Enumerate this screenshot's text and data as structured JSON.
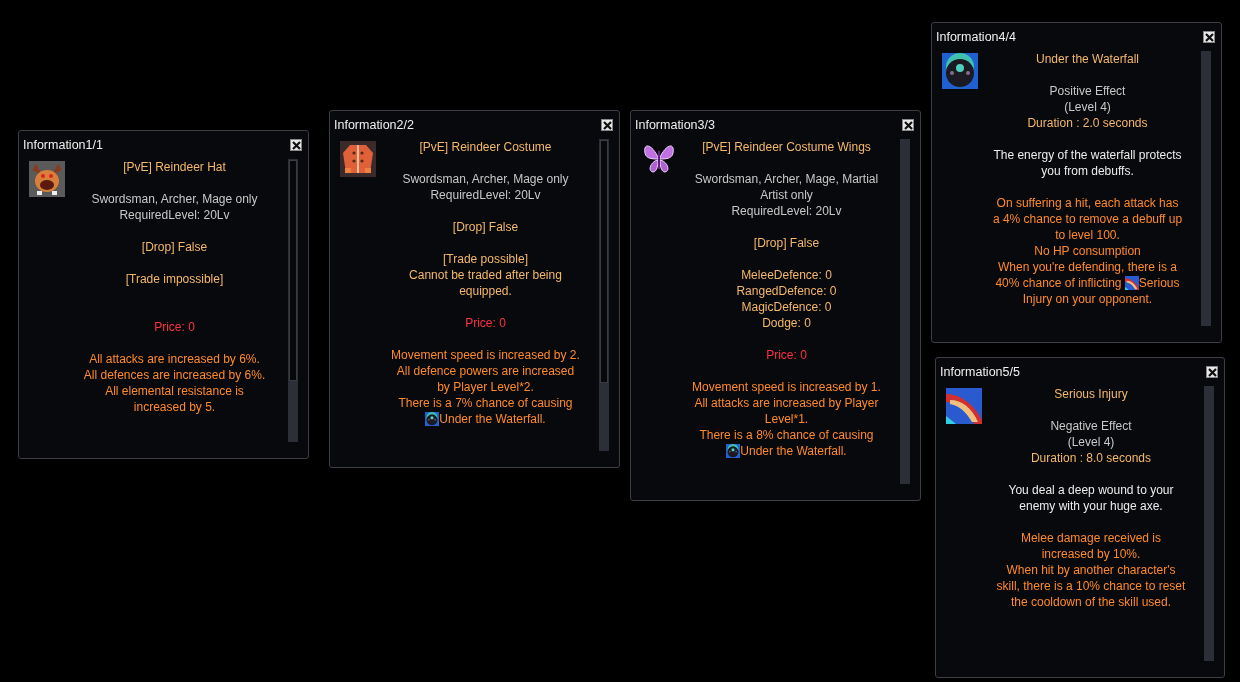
{
  "windows": [
    {
      "title": "Information1/1",
      "scrollable": true,
      "lines": [
        {
          "kind": "name",
          "text": "[PvE] Reindeer Hat"
        },
        {
          "kind": "blank"
        },
        {
          "kind": "info",
          "text": "Swordsman, Archer, Mage only"
        },
        {
          "kind": "info",
          "text": "RequiredLevel: 20Lv"
        },
        {
          "kind": "blank"
        },
        {
          "kind": "trade",
          "text": "[Drop] False"
        },
        {
          "kind": "blank"
        },
        {
          "kind": "trade",
          "text": "[Trade impossible]"
        },
        {
          "kind": "blank"
        },
        {
          "kind": "blank"
        },
        {
          "kind": "price",
          "text": "Price: 0"
        },
        {
          "kind": "blank"
        },
        {
          "kind": "effect",
          "text": "All attacks are increased by 6%."
        },
        {
          "kind": "effect",
          "text": "All defences are increased by 6%."
        },
        {
          "kind": "effect",
          "text": "All elemental resistance is increased by 5."
        }
      ]
    },
    {
      "title": "Information2/2",
      "scrollable": true,
      "lines": [
        {
          "kind": "name",
          "text": "[PvE] Reindeer Costume"
        },
        {
          "kind": "blank"
        },
        {
          "kind": "info",
          "text": "Swordsman, Archer, Mage only"
        },
        {
          "kind": "info",
          "text": "RequiredLevel: 20Lv"
        },
        {
          "kind": "blank"
        },
        {
          "kind": "trade",
          "text": "[Drop] False"
        },
        {
          "kind": "blank"
        },
        {
          "kind": "trade",
          "text": "[Trade possible]"
        },
        {
          "kind": "trade",
          "text": "Cannot be traded after being equipped."
        },
        {
          "kind": "blank"
        },
        {
          "kind": "price",
          "text": "Price: 0"
        },
        {
          "kind": "blank"
        },
        {
          "kind": "effect",
          "text": "Movement speed is increased by 2."
        },
        {
          "kind": "effect",
          "text": "All defence powers are increased by Player Level*2."
        },
        {
          "kind": "effect",
          "text": "There is a 7% chance of causing"
        },
        {
          "kind": "effect_icon",
          "after": "Under the Waterfall."
        }
      ]
    },
    {
      "title": "Information3/3",
      "scrollable": false,
      "lines": [
        {
          "kind": "name",
          "text": "[PvE] Reindeer Costume Wings"
        },
        {
          "kind": "blank"
        },
        {
          "kind": "info",
          "text": "Swordsman, Archer, Mage, Martial Artist only"
        },
        {
          "kind": "info",
          "text": "RequiredLevel: 20Lv"
        },
        {
          "kind": "blank"
        },
        {
          "kind": "trade",
          "text": "[Drop] False"
        },
        {
          "kind": "blank"
        },
        {
          "kind": "trade",
          "text": "MeleeDefence: 0"
        },
        {
          "kind": "trade",
          "text": "RangedDefence: 0"
        },
        {
          "kind": "trade",
          "text": "MagicDefence: 0"
        },
        {
          "kind": "trade",
          "text": "Dodge: 0"
        },
        {
          "kind": "blank"
        },
        {
          "kind": "price",
          "text": "Price: 0"
        },
        {
          "kind": "blank"
        },
        {
          "kind": "effect",
          "text": "Movement speed is increased by 1."
        },
        {
          "kind": "effect",
          "text": "All attacks are increased by Player Level*1."
        },
        {
          "kind": "effect",
          "text": "There is a 8% chance of causing"
        },
        {
          "kind": "effect_icon",
          "after": "Under the Waterfall."
        }
      ]
    },
    {
      "title": "Information4/4",
      "scrollable": false,
      "lines": [
        {
          "kind": "name",
          "text": "Under the Waterfall"
        },
        {
          "kind": "blank"
        },
        {
          "kind": "info",
          "text": "Positive Effect"
        },
        {
          "kind": "info",
          "text": "(Level 4)"
        },
        {
          "kind": "trade",
          "text": "Duration : 2.0 seconds"
        },
        {
          "kind": "blank"
        },
        {
          "kind": "desc",
          "text": "The energy of the waterfall protects you from debuffs."
        },
        {
          "kind": "blank"
        },
        {
          "kind": "effect",
          "text": "On suffering a hit, each attack has a 4% chance to remove a debuff up to level 100."
        },
        {
          "kind": "effect",
          "text": "No HP consumption"
        },
        {
          "kind": "effect",
          "text": "When you're defending, there is a"
        },
        {
          "kind": "effect_icon",
          "text": "40% chance of inflicting",
          "after": "Serious"
        },
        {
          "kind": "effect",
          "text": "Injury on your opponent."
        }
      ]
    },
    {
      "title": "Information5/5",
      "scrollable": false,
      "lines": [
        {
          "kind": "name",
          "text": "Serious Injury"
        },
        {
          "kind": "blank"
        },
        {
          "kind": "info",
          "text": "Negative Effect"
        },
        {
          "kind": "info",
          "text": "(Level 4)"
        },
        {
          "kind": "trade",
          "text": "Duration : 8.0 seconds"
        },
        {
          "kind": "blank"
        },
        {
          "kind": "desc",
          "text": "You deal a deep wound to your enemy with your huge axe."
        },
        {
          "kind": "blank"
        },
        {
          "kind": "effect",
          "text": "Melee damage received is increased by 10%."
        },
        {
          "kind": "effect",
          "text": "When hit by another character's skill, there is a 10% chance to reset the cooldown of the skill used."
        }
      ]
    }
  ]
}
